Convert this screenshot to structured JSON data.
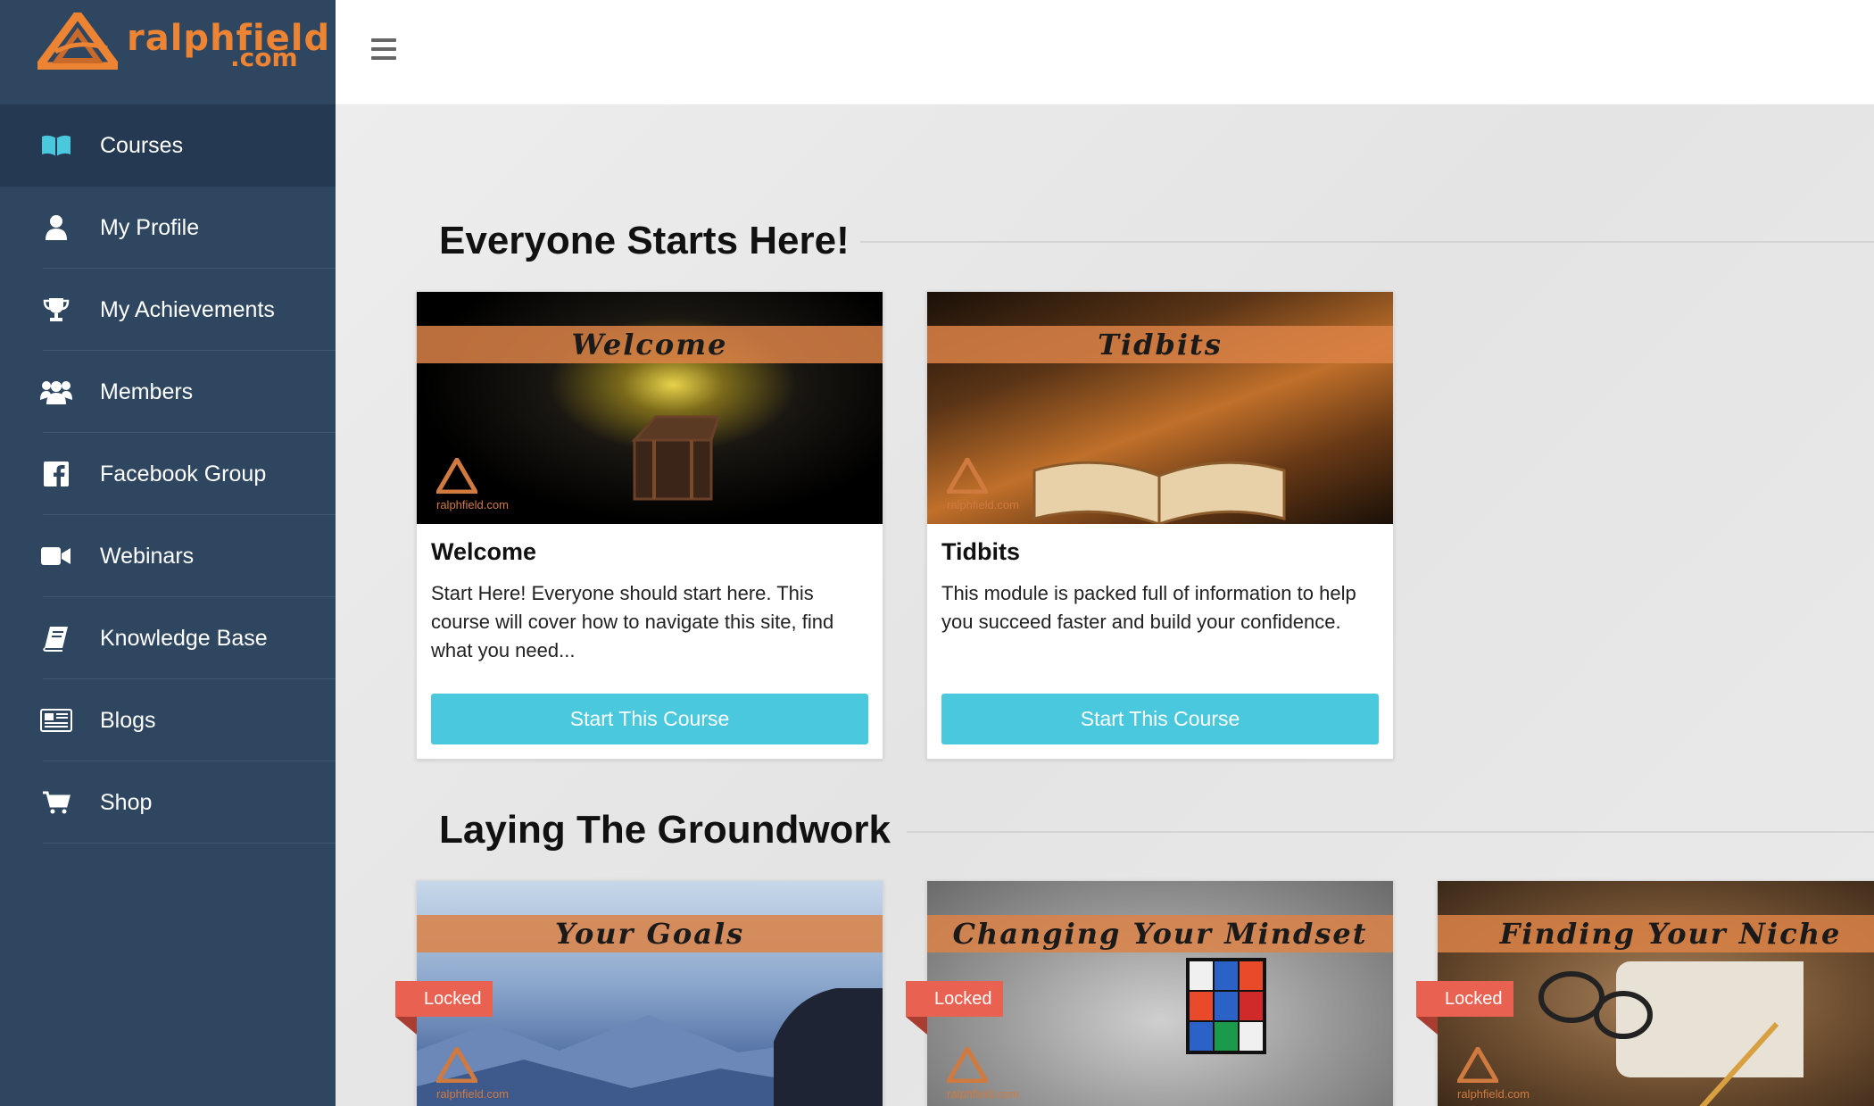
{
  "brand": {
    "name": "ralphfield",
    "suffix": ".com",
    "accent": "#ec8434"
  },
  "colors": {
    "sidebar": "#2f4660",
    "sidebar_active": "#253a52",
    "button": "#4ac9de",
    "locked": "#e96151"
  },
  "sidebar": {
    "items": [
      {
        "label": "Courses",
        "icon": "book-open-icon",
        "active": true
      },
      {
        "label": "My Profile",
        "icon": "user-icon"
      },
      {
        "label": "My Achievements",
        "icon": "trophy-icon"
      },
      {
        "label": "Members",
        "icon": "users-icon"
      },
      {
        "label": "Facebook Group",
        "icon": "facebook-icon"
      },
      {
        "label": "Webinars",
        "icon": "video-camera-icon"
      },
      {
        "label": "Knowledge Base",
        "icon": "book-icon"
      },
      {
        "label": "Blogs",
        "icon": "newspaper-icon"
      },
      {
        "label": "Shop",
        "icon": "shopping-cart-icon"
      }
    ]
  },
  "topbar": {
    "menu_icon": "hamburger-icon"
  },
  "sections": [
    {
      "title": "Everyone Starts Here!",
      "courses": [
        {
          "thumb_title": "Welcome",
          "watermark": "ralphfield.com",
          "title": "Welcome",
          "description": "Start Here! Everyone should start here.  This course will cover how to navigate this site, find what you need...",
          "button": "Start This Course"
        },
        {
          "thumb_title": "Tidbits",
          "watermark": "ralphfield.com",
          "title": "Tidbits",
          "description": "This module is packed full of information to help you succeed faster and build your confidence.",
          "button": "Start This Course"
        }
      ]
    },
    {
      "title": "Laying The Groundwork",
      "courses": [
        {
          "thumb_title": "Your Goals",
          "badge": "Locked",
          "watermark": "ralphfield.com"
        },
        {
          "thumb_title": "Changing Your Mindset",
          "badge": "Locked",
          "watermark": "ralphfield.com"
        },
        {
          "thumb_title": "Finding Your Niche",
          "badge": "Locked",
          "watermark": "ralphfield.com"
        }
      ]
    }
  ]
}
